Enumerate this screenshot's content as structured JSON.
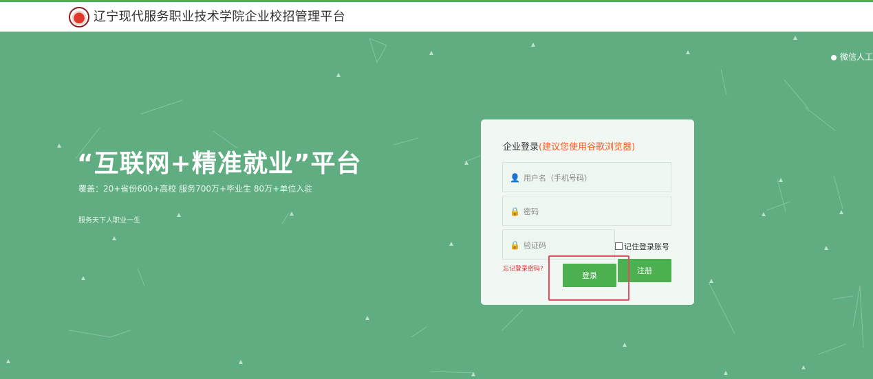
{
  "header": {
    "logo_icon": "college-logo-icon",
    "title": "辽宁现代服务职业技术学院企业校招管理平台"
  },
  "hero": {
    "wechat_label": "微信人工",
    "slogan": "“互联网+精准就业”平台",
    "coverage": "覆盖：20+省份600+高校   服务700万+毕业生   80万+单位入驻",
    "motto": "服务天下人职业一生"
  },
  "login": {
    "title": "企业登录",
    "browser_tip": "(建议您使用谷歌浏览器)",
    "username_placeholder": "用户名（手机号码）",
    "password_placeholder": "密码",
    "captcha_placeholder": "验证码",
    "remember_label": "记住登录账号",
    "forgot_label": "忘记登录密码?",
    "login_button": "登录",
    "register_button": "注册"
  },
  "colors": {
    "background": "#5fad80",
    "accent": "#4caf50",
    "tip": "#ff5a1f",
    "highlight": "#e84a5f"
  }
}
